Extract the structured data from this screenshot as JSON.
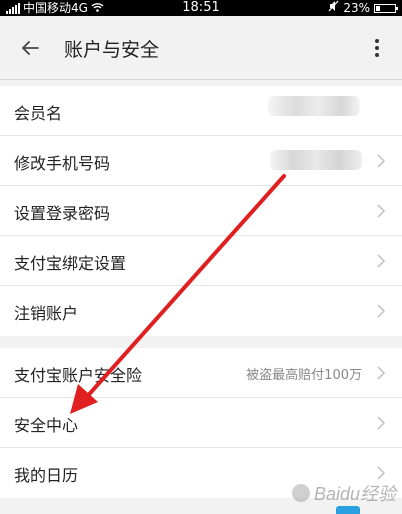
{
  "status_bar": {
    "carrier": "中国移动4G",
    "time": "18:51",
    "battery_percent_label": "23%",
    "battery_level": 0.23
  },
  "header": {
    "title": "账户与安全",
    "back_icon": "arrow-left-icon",
    "more_icon": "more-vertical-icon"
  },
  "group1": {
    "items": [
      {
        "label": "会员名"
      },
      {
        "label": "修改手机号码"
      },
      {
        "label": "设置登录密码"
      },
      {
        "label": "支付宝绑定设置"
      },
      {
        "label": "注销账户"
      }
    ]
  },
  "group2": {
    "items": [
      {
        "label": "支付宝账户安全险",
        "value": "被盗最高赔付100万"
      },
      {
        "label": "安全中心"
      },
      {
        "label": "我的日历"
      }
    ]
  },
  "overlay": {
    "arrow_color": "#e02020"
  },
  "watermark": {
    "text": "Baidu经验"
  }
}
